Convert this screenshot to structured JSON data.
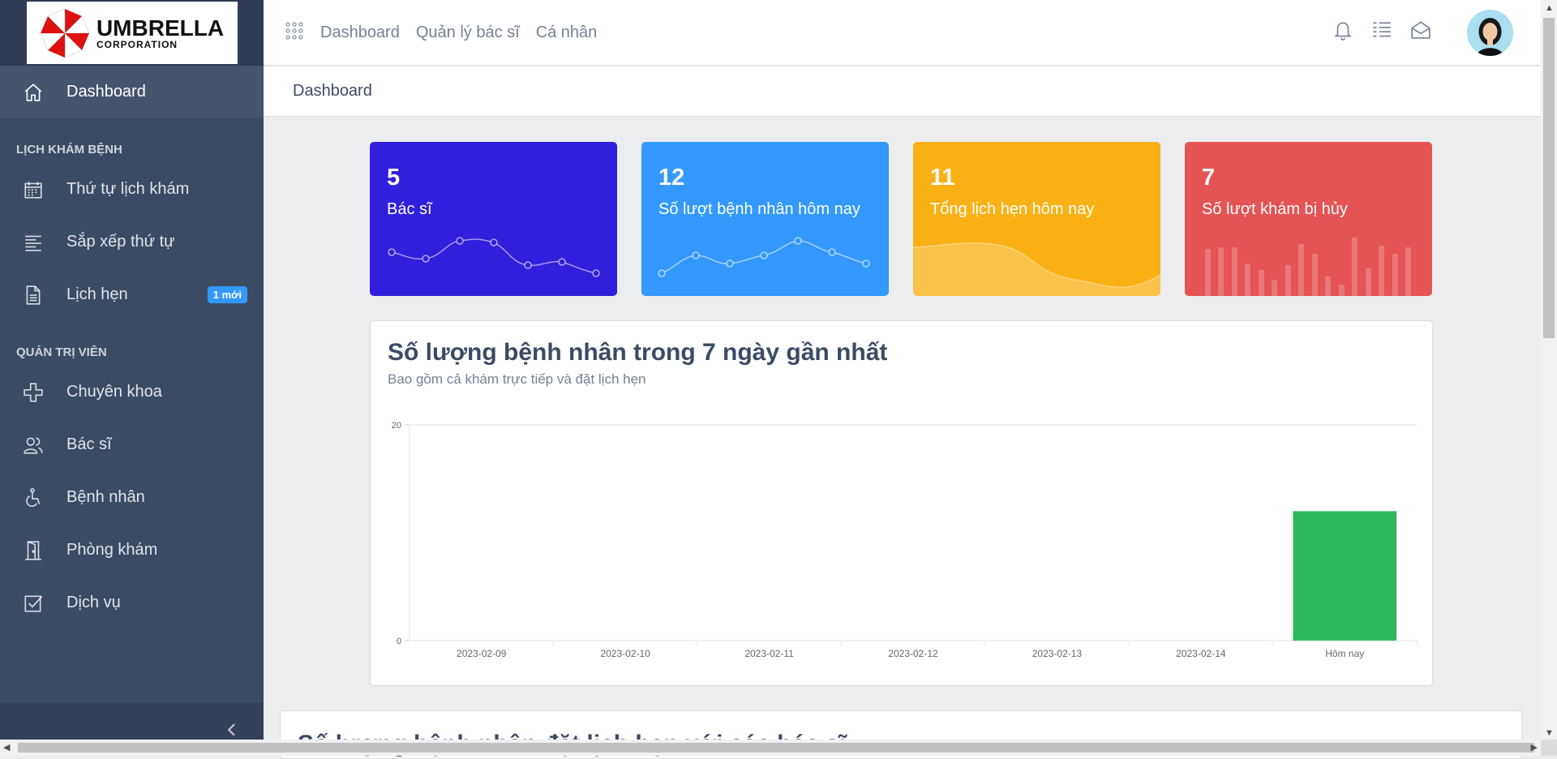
{
  "brand": {
    "line1": "UMBRELLA",
    "line2": "CORPORATION"
  },
  "sidebar": {
    "items_top": [
      {
        "label": "Dashboard",
        "icon": "home-icon"
      }
    ],
    "section1_title": "LỊCH KHÁM BỆNH",
    "section1": [
      {
        "label": "Thứ tự lịch khám",
        "icon": "calendar-icon"
      },
      {
        "label": "Sắp xếp thứ tự",
        "icon": "align-left-icon"
      },
      {
        "label": "Lịch hẹn",
        "icon": "document-icon",
        "badge": "1 mới"
      }
    ],
    "section2_title": "QUẢN TRỊ VIÊN",
    "section2": [
      {
        "label": "Chuyên khoa",
        "icon": "medical-cross-icon"
      },
      {
        "label": "Bác sĩ",
        "icon": "people-icon"
      },
      {
        "label": "Bệnh nhân",
        "icon": "wheelchair-icon"
      },
      {
        "label": "Phòng khám",
        "icon": "door-icon"
      },
      {
        "label": "Dịch vụ",
        "icon": "checkbox-icon"
      }
    ]
  },
  "header": {
    "links": [
      "Dashboard",
      "Quản lý bác sĩ",
      "Cá nhân"
    ]
  },
  "breadcrumb": "Dashboard",
  "cards": [
    {
      "value": "5",
      "label": "Bác sĩ",
      "color": "#321fdb"
    },
    {
      "value": "12",
      "label": "Số lượt bệnh nhân hôm nay",
      "color": "#3399ff"
    },
    {
      "value": "11",
      "label": "Tổng lịch hẹn hôm nay",
      "color": "#f9b115"
    },
    {
      "value": "7",
      "label": "Số lượt khám bị hủy",
      "color": "#e55353"
    }
  ],
  "chart_section": {
    "title": "Số lượng bệnh nhân trong 7 ngày gần nhất",
    "subtitle": "Bao gồm cả khám trực tiếp và đặt lịch hẹn"
  },
  "next_section": {
    "title": "Số lượng bệnh nhân đặt lịch hẹn với các bác sĩ"
  },
  "chart_data": {
    "type": "bar",
    "categories": [
      "2023-02-09",
      "2023-02-10",
      "2023-02-11",
      "2023-02-12",
      "2023-02-13",
      "2023-02-14",
      "Hôm nay"
    ],
    "values": [
      0,
      0,
      0,
      0,
      0,
      0,
      12
    ],
    "ylim": [
      0,
      20
    ],
    "yticks": [
      "0",
      "20"
    ],
    "bar_color": "#2eb85c",
    "grid": true
  }
}
